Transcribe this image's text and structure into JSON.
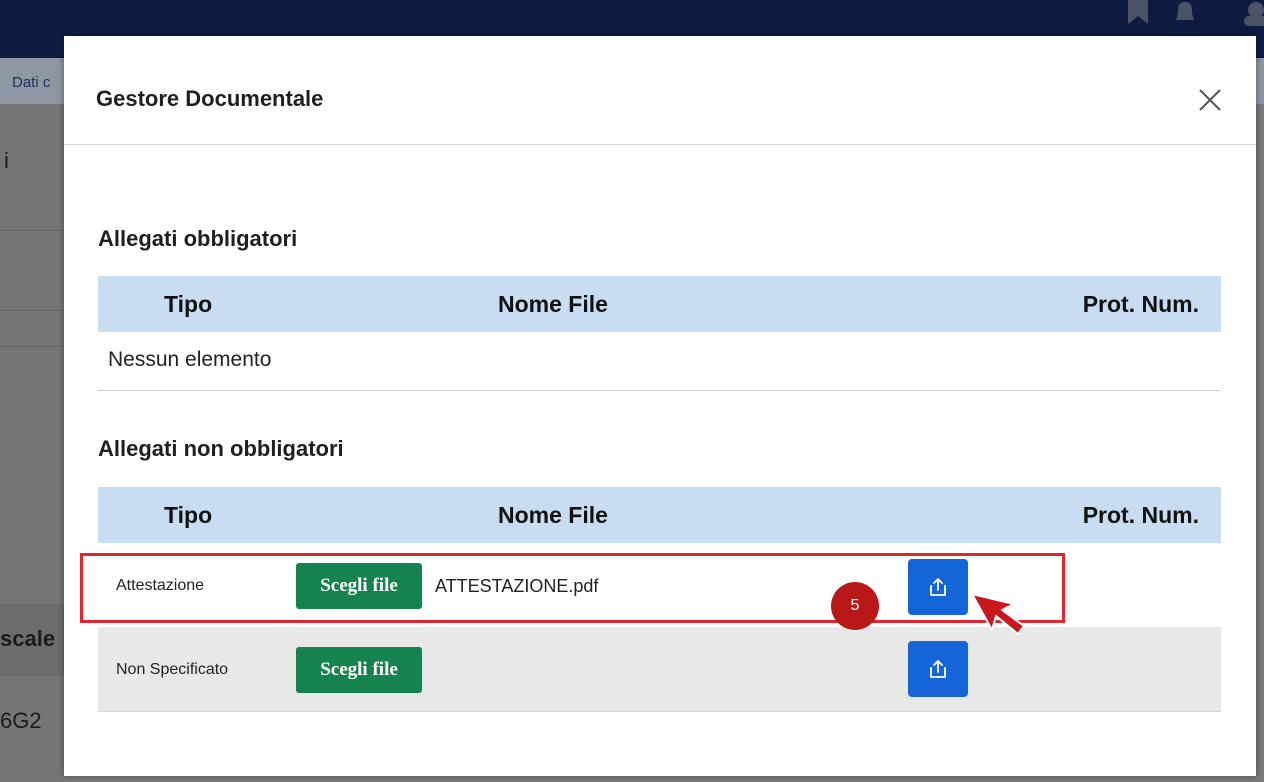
{
  "background": {
    "subbar_text": "Dati c",
    "side_text_top": "i",
    "side_text_mid": "scale",
    "side_text_bottom": "6G2"
  },
  "modal": {
    "title": "Gestore Documentale",
    "close_icon": "close-icon"
  },
  "mandatory": {
    "title": "Allegati obbligatori",
    "columns": [
      "Tipo",
      "Nome File",
      "Prot. Num."
    ],
    "empty_text": "Nessun elemento"
  },
  "optional": {
    "title": "Allegati non obbligatori",
    "columns": [
      "Tipo",
      "Nome File",
      "Prot. Num."
    ],
    "rows": [
      {
        "type": "Attestazione",
        "choose_label": "Scegli file",
        "file_name": "ATTESTAZIONE.pdf",
        "upload_icon": "upload-icon"
      },
      {
        "type": "Non Specificato",
        "choose_label": "Scegli file",
        "file_name": "",
        "upload_icon": "upload-icon"
      }
    ]
  },
  "annotation": {
    "step_number": "5",
    "highlight_color": "#e0262e"
  },
  "colors": {
    "header_navy": "#0d1c40",
    "table_header": "#c9ddf2",
    "choose_button": "#16834f",
    "upload_button": "#1565d8",
    "badge": "#b81818"
  }
}
